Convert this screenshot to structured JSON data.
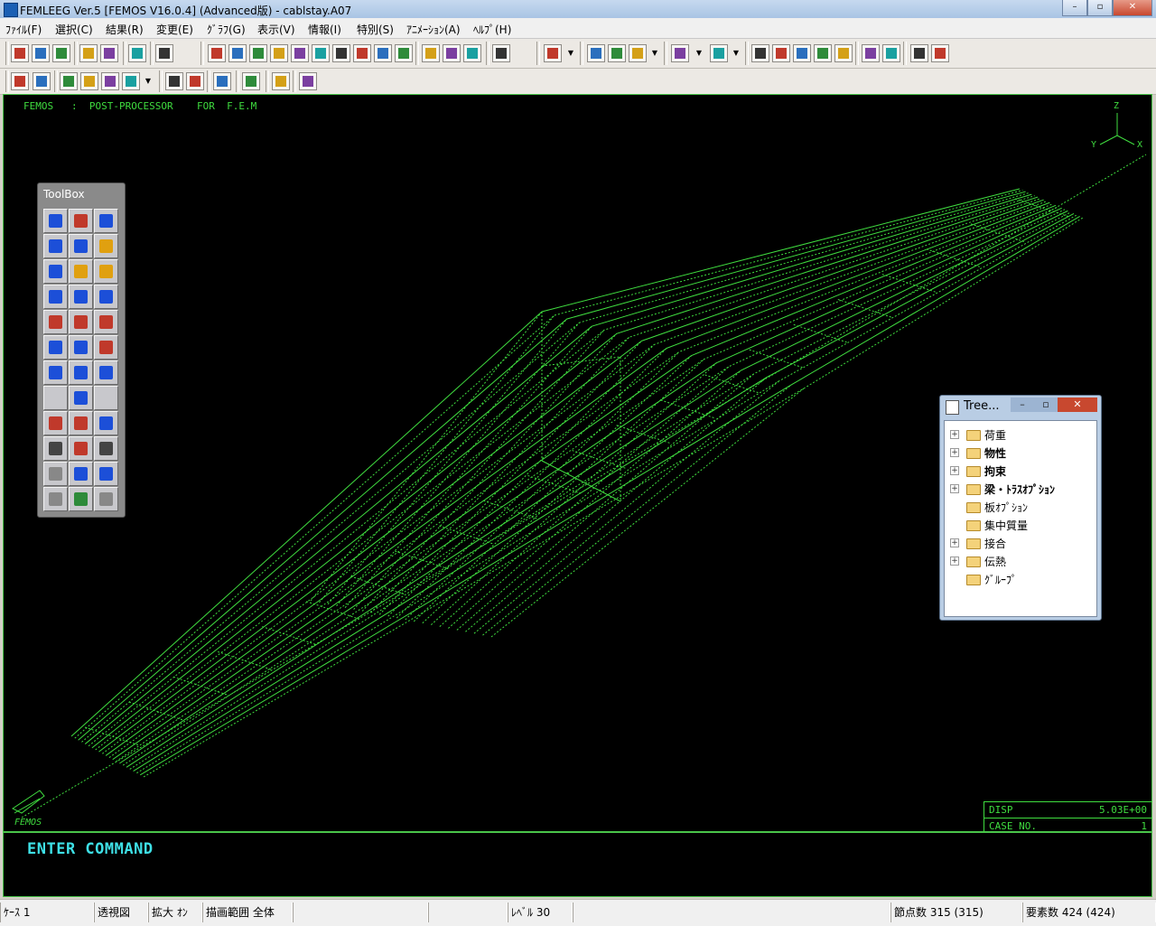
{
  "window": {
    "title": "FEMLEEG Ver.5 [FEMOS V16.0.4] (Advanced版) - cablstay.A07",
    "minimize": "–",
    "maximize": "▫",
    "close": "✕"
  },
  "menu": [
    "ﾌｧｲﾙ(F)",
    "選択(C)",
    "結果(R)",
    "変更(E)",
    "ｸﾞﾗﾌ(G)",
    "表示(V)",
    "情報(I)",
    "特別(S)",
    "ｱﾆﾒｰｼｮﾝ(A)",
    "ﾍﾙﾌﾟ(H)"
  ],
  "viewport": {
    "header": "FEMOS   :  POST-PROCESSOR    FOR  F.E.M",
    "axis_labels": {
      "z": "Z",
      "x": "X",
      "y": "Y"
    },
    "disp_label": "DISP",
    "disp_value": "5.03E+00",
    "case_label": "CASE NO.",
    "case_value": "1",
    "logo_text": "FEMOS"
  },
  "command": {
    "prompt": "ENTER COMMAND"
  },
  "toolbox": {
    "title": "ToolBox"
  },
  "tree": {
    "title": "Tree...",
    "nodes": [
      {
        "label": "荷重",
        "expandable": true,
        "bold": false
      },
      {
        "label": "物性",
        "expandable": true,
        "bold": true
      },
      {
        "label": "拘束",
        "expandable": true,
        "bold": true
      },
      {
        "label": "梁・ﾄﾗｽｵﾌﾟｼｮﾝ",
        "expandable": true,
        "bold": true
      },
      {
        "label": "板ｵﾌﾟｼｮﾝ",
        "expandable": false,
        "bold": false
      },
      {
        "label": "集中質量",
        "expandable": false,
        "bold": false
      },
      {
        "label": "接合",
        "expandable": true,
        "bold": false
      },
      {
        "label": "伝熱",
        "expandable": true,
        "bold": false
      },
      {
        "label": "ｸﾞﾙｰﾌﾟ",
        "expandable": false,
        "bold": false
      }
    ]
  },
  "status": {
    "case": "ｹｰｽ 1",
    "view": "透視図",
    "zoom": "拡大 ｵﾝ",
    "range": "描画範囲 全体",
    "level": "ﾚﾍﾞﾙ 30",
    "nodes": "節点数 315 (315)",
    "elements": "要素数 424 (424)"
  },
  "colors": {
    "wireframe": "#3fdc3f",
    "command_text": "#3ee0e6",
    "background": "#000000"
  }
}
